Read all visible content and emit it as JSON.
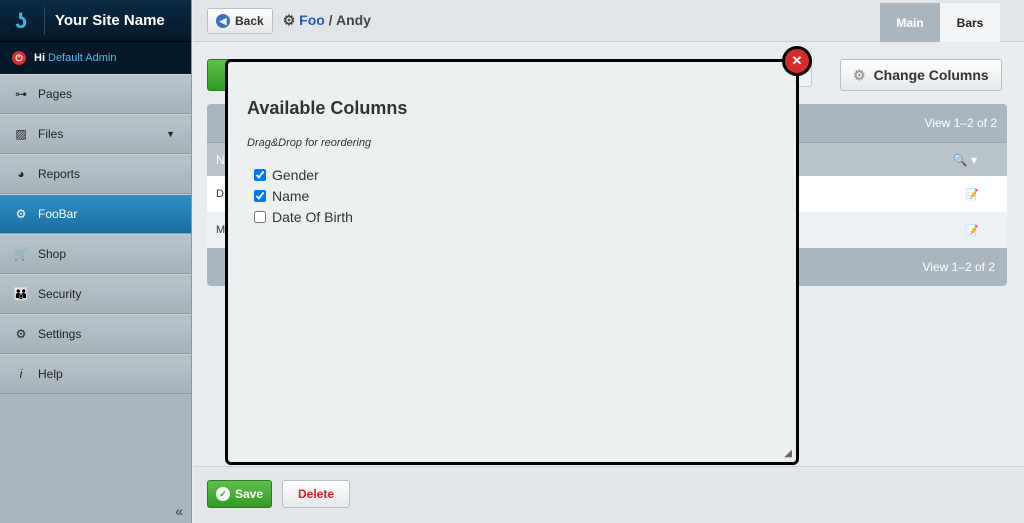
{
  "brand": {
    "name": "Your Site Name"
  },
  "user": {
    "greeting": "Hi",
    "name": "Default Admin"
  },
  "sidebar": {
    "items": [
      {
        "label": "Pages",
        "icon": "sitemap-icon"
      },
      {
        "label": "Files",
        "icon": "image-icon"
      },
      {
        "label": "Reports",
        "icon": "pie-chart-icon"
      },
      {
        "label": "FooBar",
        "icon": "gears-icon",
        "active": true
      },
      {
        "label": "Shop",
        "icon": "cart-icon"
      },
      {
        "label": "Security",
        "icon": "users-icon"
      },
      {
        "label": "Settings",
        "icon": "gear-icon"
      },
      {
        "label": "Help",
        "icon": "info-icon"
      }
    ],
    "collapse": "«"
  },
  "header": {
    "back": "Back",
    "crumb_foo": "Foo",
    "crumb_sep": " / ",
    "crumb_current": "Andy",
    "tabs": [
      "Main",
      "Bars"
    ]
  },
  "toolbar": {
    "change_columns": "Change Columns"
  },
  "grid": {
    "view_top": "View 1–2 of 2",
    "view_bottom": "View 1–2 of 2",
    "header_first": "N",
    "rows": [
      "D",
      "M"
    ]
  },
  "modal": {
    "title": "Available Columns",
    "hint": "Drag&Drop for reordering",
    "columns": [
      {
        "label": "Gender",
        "checked": true
      },
      {
        "label": "Name",
        "checked": true
      },
      {
        "label": "Date Of Birth",
        "checked": false
      }
    ]
  },
  "footer": {
    "save": "Save",
    "delete": "Delete"
  },
  "colors": {
    "accent": "#1c6f9f",
    "save": "#2f9a23",
    "delete": "#e02020",
    "close": "#d62b2b"
  }
}
